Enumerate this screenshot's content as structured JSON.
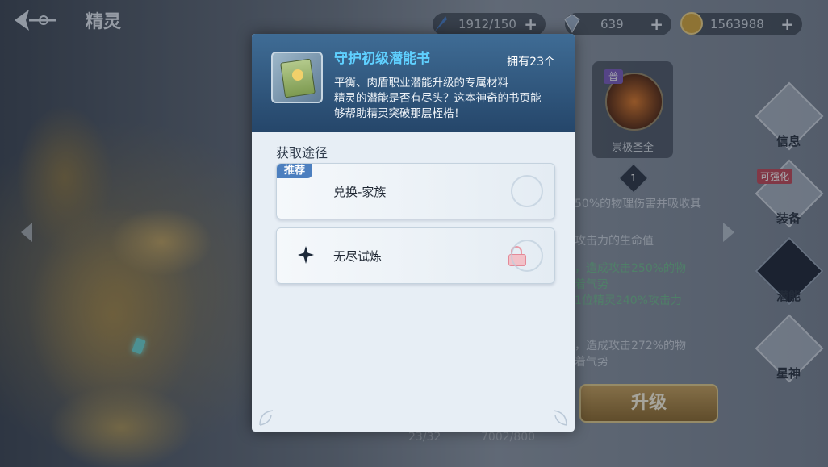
{
  "header": {
    "title": "精灵",
    "resources": [
      {
        "name": "stamina",
        "value": "1912/150",
        "icon": "feather-icon"
      },
      {
        "name": "diamond",
        "value": "639",
        "icon": "diamond-icon"
      },
      {
        "name": "gold",
        "value": "1563988",
        "icon": "coin-icon"
      }
    ],
    "plus": "+"
  },
  "background_panel": {
    "skill_badge": "普",
    "skill_name": "崇极圣全",
    "step_number": "1",
    "lines": [
      "50%的物理伤害并吸收其",
      "攻击力的生命值",
      "，造成攻击250%的物",
      "着气势",
      "1位精灵240%攻击力",
      "，造成攻击272%的物",
      "着气势"
    ],
    "upgrade_button": "升级",
    "stats_left": "23/32",
    "stats_right": "7002/800",
    "enhance_badge": "可强化",
    "tabs": [
      "信息",
      "装备",
      "潜能",
      "星神"
    ],
    "active_tab_index": 2
  },
  "popup": {
    "item_name": "守护初级潜能书",
    "item_count": "拥有23个",
    "description": [
      "平衡、肉盾职业潜能升级的专属材料",
      "精灵的潜能是否有尽头？这本神奇的书页能",
      "够帮助精灵突破那层桎梏！"
    ],
    "sources_title": "获取途径",
    "sources": [
      {
        "tag": "推荐",
        "label": "兑换-家族",
        "locked": false
      },
      {
        "tag": "",
        "label": "无尽试炼",
        "locked": true
      }
    ]
  },
  "colors": {
    "item_name": "#5fd0ff",
    "popup_header": "#2f5880",
    "recommend_tag": "#4c7fbf",
    "upgrade_button": "#b88f4a"
  }
}
